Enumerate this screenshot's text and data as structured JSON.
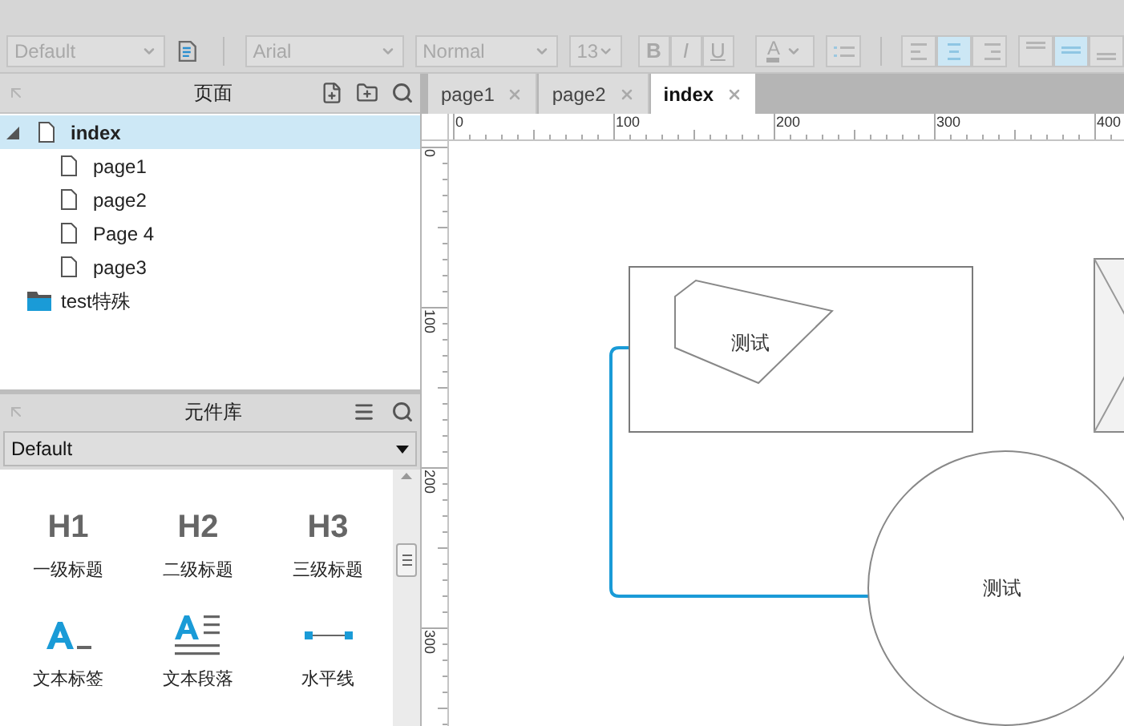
{
  "toolbar": {
    "disabled": true,
    "style_select": "Default",
    "font_select": "Arial",
    "weight_select": "Normal",
    "size_select": "13",
    "format_buttons": [
      {
        "label": "B",
        "kind": "bold"
      },
      {
        "label": "I",
        "kind": "italic"
      },
      {
        "label": "U",
        "kind": "underline"
      }
    ],
    "font_color_label": "A",
    "align_buttons": [
      {
        "kind": "left",
        "selected": false
      },
      {
        "kind": "center",
        "selected": true
      },
      {
        "kind": "right",
        "selected": false
      }
    ],
    "valign_buttons": [
      {
        "kind": "top",
        "selected": false
      },
      {
        "kind": "middle",
        "selected": true
      },
      {
        "kind": "bottom",
        "selected": false
      }
    ]
  },
  "pages_panel": {
    "title": "页面",
    "tree": [
      {
        "label": "index",
        "kind": "page",
        "expanded": true,
        "selected": true,
        "children": [
          {
            "label": "page1",
            "kind": "page",
            "selected": false
          },
          {
            "label": "page2",
            "kind": "page",
            "selected": false
          },
          {
            "label": "Page 4",
            "kind": "page",
            "selected": false
          },
          {
            "label": "page3",
            "kind": "page",
            "selected": false
          }
        ]
      },
      {
        "label": "test特殊",
        "kind": "folder",
        "selected": false
      }
    ]
  },
  "library_panel": {
    "title": "元件库",
    "select": "Default",
    "items": [
      {
        "kind": "heading",
        "glyph": "H1",
        "label": "一级标题"
      },
      {
        "kind": "heading",
        "glyph": "H2",
        "label": "二级标题"
      },
      {
        "kind": "heading",
        "glyph": "H3",
        "label": "三级标题"
      },
      {
        "kind": "text-label",
        "label": "文本标签"
      },
      {
        "kind": "paragraph",
        "label": "文本段落"
      },
      {
        "kind": "horizontal-line",
        "label": "水平线"
      }
    ]
  },
  "tabs": [
    {
      "label": "page1",
      "selected": false
    },
    {
      "label": "page2",
      "selected": false
    },
    {
      "label": "index",
      "selected": true
    }
  ],
  "rulers": {
    "top_labels": [
      "0",
      "100",
      "200",
      "300",
      "400"
    ],
    "left_labels": [
      "0",
      "100",
      "200",
      "300"
    ]
  },
  "canvas": {
    "shapes": [
      {
        "kind": "rectangle"
      },
      {
        "kind": "polygon",
        "text": "测试"
      },
      {
        "kind": "image-placeholder"
      },
      {
        "kind": "circle",
        "text": "测试"
      },
      {
        "kind": "connector"
      }
    ]
  }
}
